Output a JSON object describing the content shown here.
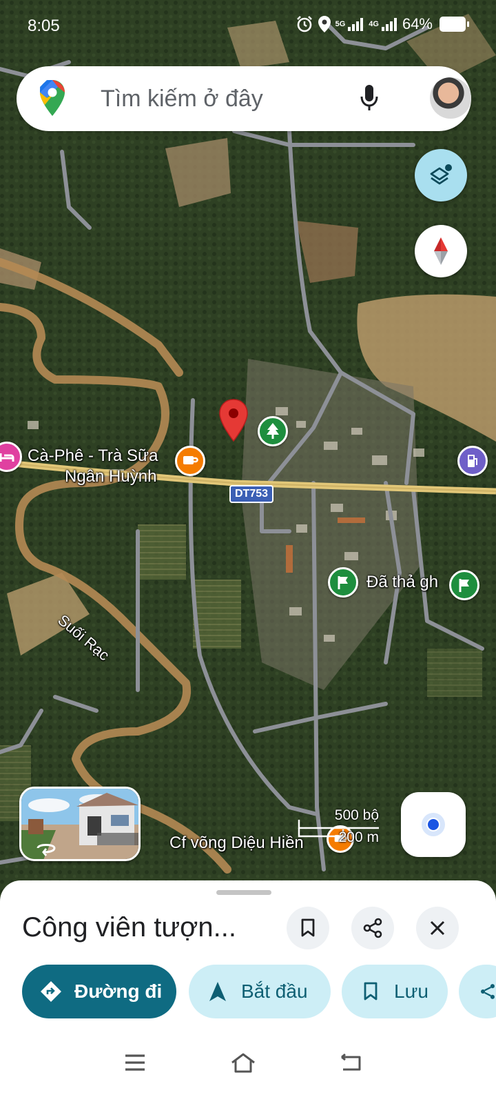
{
  "status_bar": {
    "time": "8:05",
    "net1": "5G",
    "net2": "4G",
    "battery": "64%"
  },
  "search": {
    "placeholder": "Tìm kiếm ở đây"
  },
  "map": {
    "road_label": "DT753",
    "labels": {
      "cafe_line1": "Cà-Phê - Trà Sữa",
      "cafe_line2": "Ngân Huỳnh",
      "stream": "Suối Rạc",
      "flag_place": "Đã thả gh",
      "cafe2": "Cf võng Diệu Hiền"
    },
    "scale": {
      "feet": "500 bộ",
      "meters": "200 m"
    }
  },
  "sheet": {
    "title": "Công viên tượn...",
    "chips": {
      "directions": "Đường đi",
      "start": "Bắt đầu",
      "save": "Lưu"
    }
  },
  "colors": {
    "primary": "#0f6b82",
    "chip_secondary": "#cdeef6",
    "pin_red": "#e53935",
    "poi_green": "#1e8e3e",
    "poi_orange": "#f57c00",
    "poi_pink": "#e040a0",
    "poi_purple": "#6f5fc8"
  }
}
